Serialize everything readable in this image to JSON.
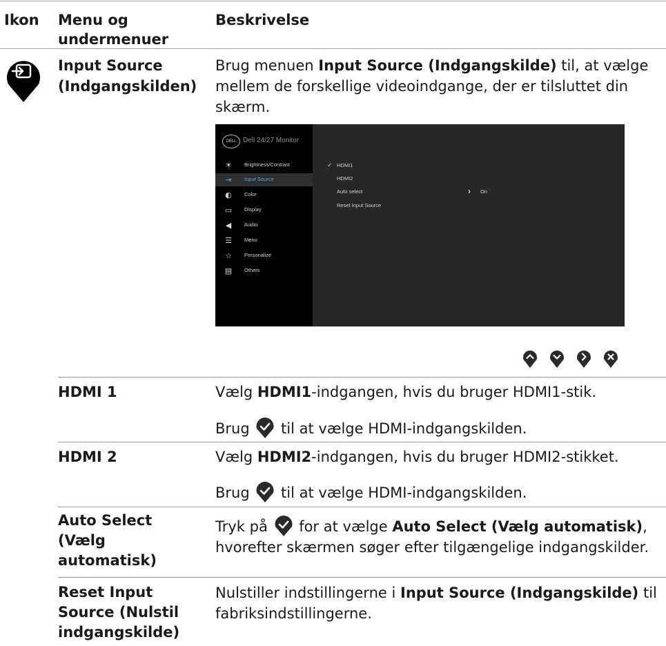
{
  "headers": {
    "icon": "Ikon",
    "menu": "Menu og undermenuer",
    "desc": "Beskrivelse"
  },
  "section": {
    "icon": "input-source-icon",
    "title": "Input Source (Indgangskilden)",
    "intro_pre": "Brug menuen ",
    "intro_bold": "Input Source (Indgangskilde)",
    "intro_post": " til, at vælge mellem de forskellige videoindgange, der er tilsluttet din skærm."
  },
  "osd": {
    "logo": "DELL",
    "title": "Dell 24/27 Monitor",
    "menu": [
      {
        "label": "Brightness/Contrast",
        "icon": "sun-icon"
      },
      {
        "label": "Input Source",
        "icon": "input-icon"
      },
      {
        "label": "Color",
        "icon": "palette-icon"
      },
      {
        "label": "Display",
        "icon": "monitor-icon"
      },
      {
        "label": "Audio",
        "icon": "speaker-icon"
      },
      {
        "label": "Menu",
        "icon": "menu-icon"
      },
      {
        "label": "Personalize",
        "icon": "star-icon"
      },
      {
        "label": "Others",
        "icon": "others-icon"
      }
    ],
    "options": [
      "HDMI1",
      "HDMI2",
      "Auto select",
      "Reset Input Source"
    ],
    "auto_value": "On",
    "selected_option": "HDMI1",
    "active_menu": "Input Source"
  },
  "nav_buttons": [
    "up-button-icon",
    "down-button-icon",
    "right-button-icon",
    "close-button-icon"
  ],
  "rows": [
    {
      "name": "HDMI 1",
      "l1_pre": "Vælg ",
      "l1_bold": "HDMI1",
      "l1_post": "-indgangen, hvis du bruger HDMI1-stik.",
      "l2_pre": "Brug ",
      "l2_post": " til at vælge HDMI-indgangskilden."
    },
    {
      "name": "HDMI 2",
      "l1_pre": "Vælg ",
      "l1_bold": "HDMI2",
      "l1_post": "-indgangen, hvis du bruger HDMI2-stikket.",
      "l2_pre": "Brug ",
      "l2_post": " til at vælge HDMI-indgangskilden."
    },
    {
      "name": "Auto Select (Vælg automatisk)",
      "pre": "Tryk på ",
      "mid": " for at vælge ",
      "bold": "Auto Select (Vælg automatisk)",
      "post": ", hvorefter skærmen søger efter tilgængelige indgangskilder."
    },
    {
      "name": "Reset Input Source (Nulstil indgangskilde)",
      "pre": "Nulstiller indstillingerne i ",
      "bold": "Input Source (Indgangskilde)",
      "post": " til fabriksindstillingerne."
    }
  ],
  "colors": {
    "check_button": "#2a2a2a",
    "osd_bg": "#272727",
    "osd_accent": "#4aa8e8"
  }
}
